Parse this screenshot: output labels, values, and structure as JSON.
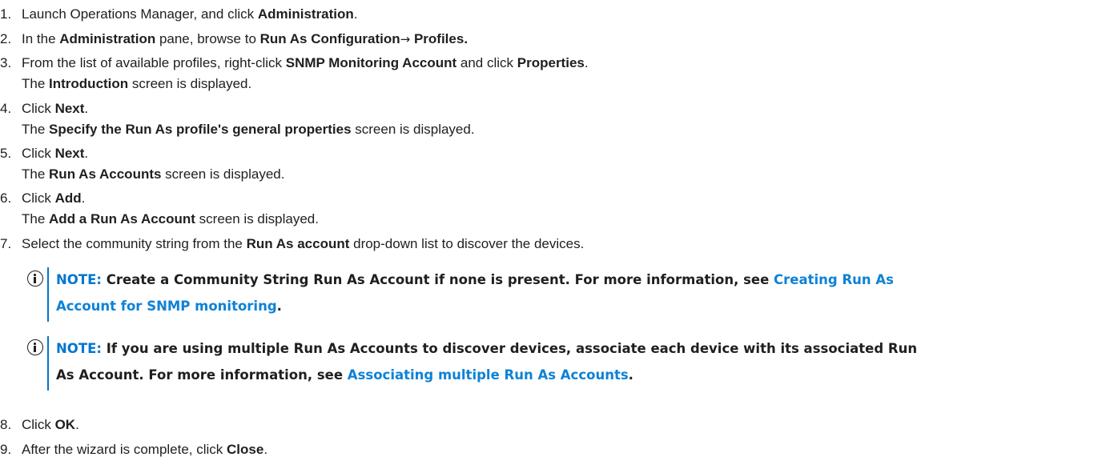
{
  "steps": [
    {
      "num": "1.",
      "parts": [
        "Launch Operations Manager, and click ",
        "Administration",
        "."
      ]
    },
    {
      "num": "2.",
      "parts": [
        "In the ",
        "Administration",
        " pane, browse to ",
        "Run As Configuration",
        "→",
        " Profiles."
      ]
    },
    {
      "num": "3.",
      "parts": [
        "From the list of available profiles, right-click ",
        "SNMP Monitoring Account",
        " and click ",
        "Properties",
        "."
      ],
      "sub": [
        "The ",
        "Introduction",
        " screen is displayed."
      ]
    },
    {
      "num": "4.",
      "parts": [
        "Click ",
        "Next",
        "."
      ],
      "sub": [
        "The ",
        "Specify the Run As profile's general properties",
        " screen is displayed."
      ]
    },
    {
      "num": "5.",
      "parts": [
        "Click ",
        "Next",
        "."
      ],
      "sub": [
        "The ",
        "Run As Accounts",
        " screen is displayed."
      ]
    },
    {
      "num": "6.",
      "parts": [
        "Click ",
        "Add",
        "."
      ],
      "sub": [
        "The ",
        "Add a Run As Account",
        " screen is displayed."
      ]
    },
    {
      "num": "7.",
      "parts": [
        "Select the community string from the ",
        "Run As account",
        " drop-down list to discover the devices."
      ]
    },
    {
      "num": "8.",
      "parts": [
        "Click ",
        "OK",
        "."
      ]
    },
    {
      "num": "9.",
      "parts": [
        "After the wizard is complete, click ",
        "Close",
        "."
      ]
    }
  ],
  "notes": [
    {
      "label": "NOTE:",
      "text1": " Create a Community String Run As Account if none is present. For more information, see ",
      "link1": "Creating Run As",
      "link2": "Account for SNMP monitoring",
      "end": "."
    },
    {
      "label": "NOTE:",
      "text1": " If you are using multiple Run As Accounts to discover devices, associate each device with its associated Run",
      "text2": "As Account. For more information, see ",
      "link": "Associating multiple Run As Accounts",
      "end": "."
    }
  ],
  "colors": {
    "accent": "#0076ce",
    "text": "#1f1f1f"
  },
  "icons": {
    "note": "info-circle-icon"
  }
}
